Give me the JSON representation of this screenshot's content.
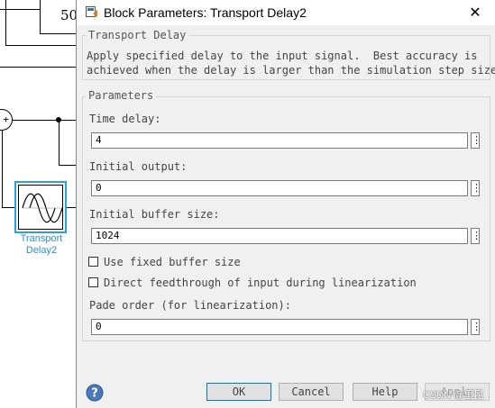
{
  "canvas": {
    "gain_block_text": "50",
    "sum_sign": "+",
    "transport_block_label": [
      "Transport",
      "Delay2"
    ]
  },
  "dialog": {
    "title": "Block Parameters: Transport Delay2",
    "description_group": {
      "legend": "Transport Delay",
      "text": "Apply specified delay to the input signal.  Best accuracy is\nachieved when the delay is larger than the simulation step size."
    },
    "parameters_group": {
      "legend": "Parameters",
      "time_delay": {
        "label": "Time delay:",
        "value": "4"
      },
      "initial_output": {
        "label": "Initial output:",
        "value": "0"
      },
      "initial_buffer_size": {
        "label": "Initial buffer size:",
        "value": "1024"
      },
      "use_fixed_buffer_size": {
        "label": "Use fixed buffer size",
        "checked": false
      },
      "direct_feedthrough": {
        "label": "Direct feedthrough of input during linearization",
        "checked": false
      },
      "pade_order": {
        "label": "Pade order (for linearization):",
        "value": "0"
      },
      "more_button_glyph": "⋮"
    },
    "buttons": {
      "ok": "OK",
      "cancel": "Cancel",
      "help": "Help",
      "apply": "Apply"
    },
    "watermark": "CSDN @里昆"
  }
}
